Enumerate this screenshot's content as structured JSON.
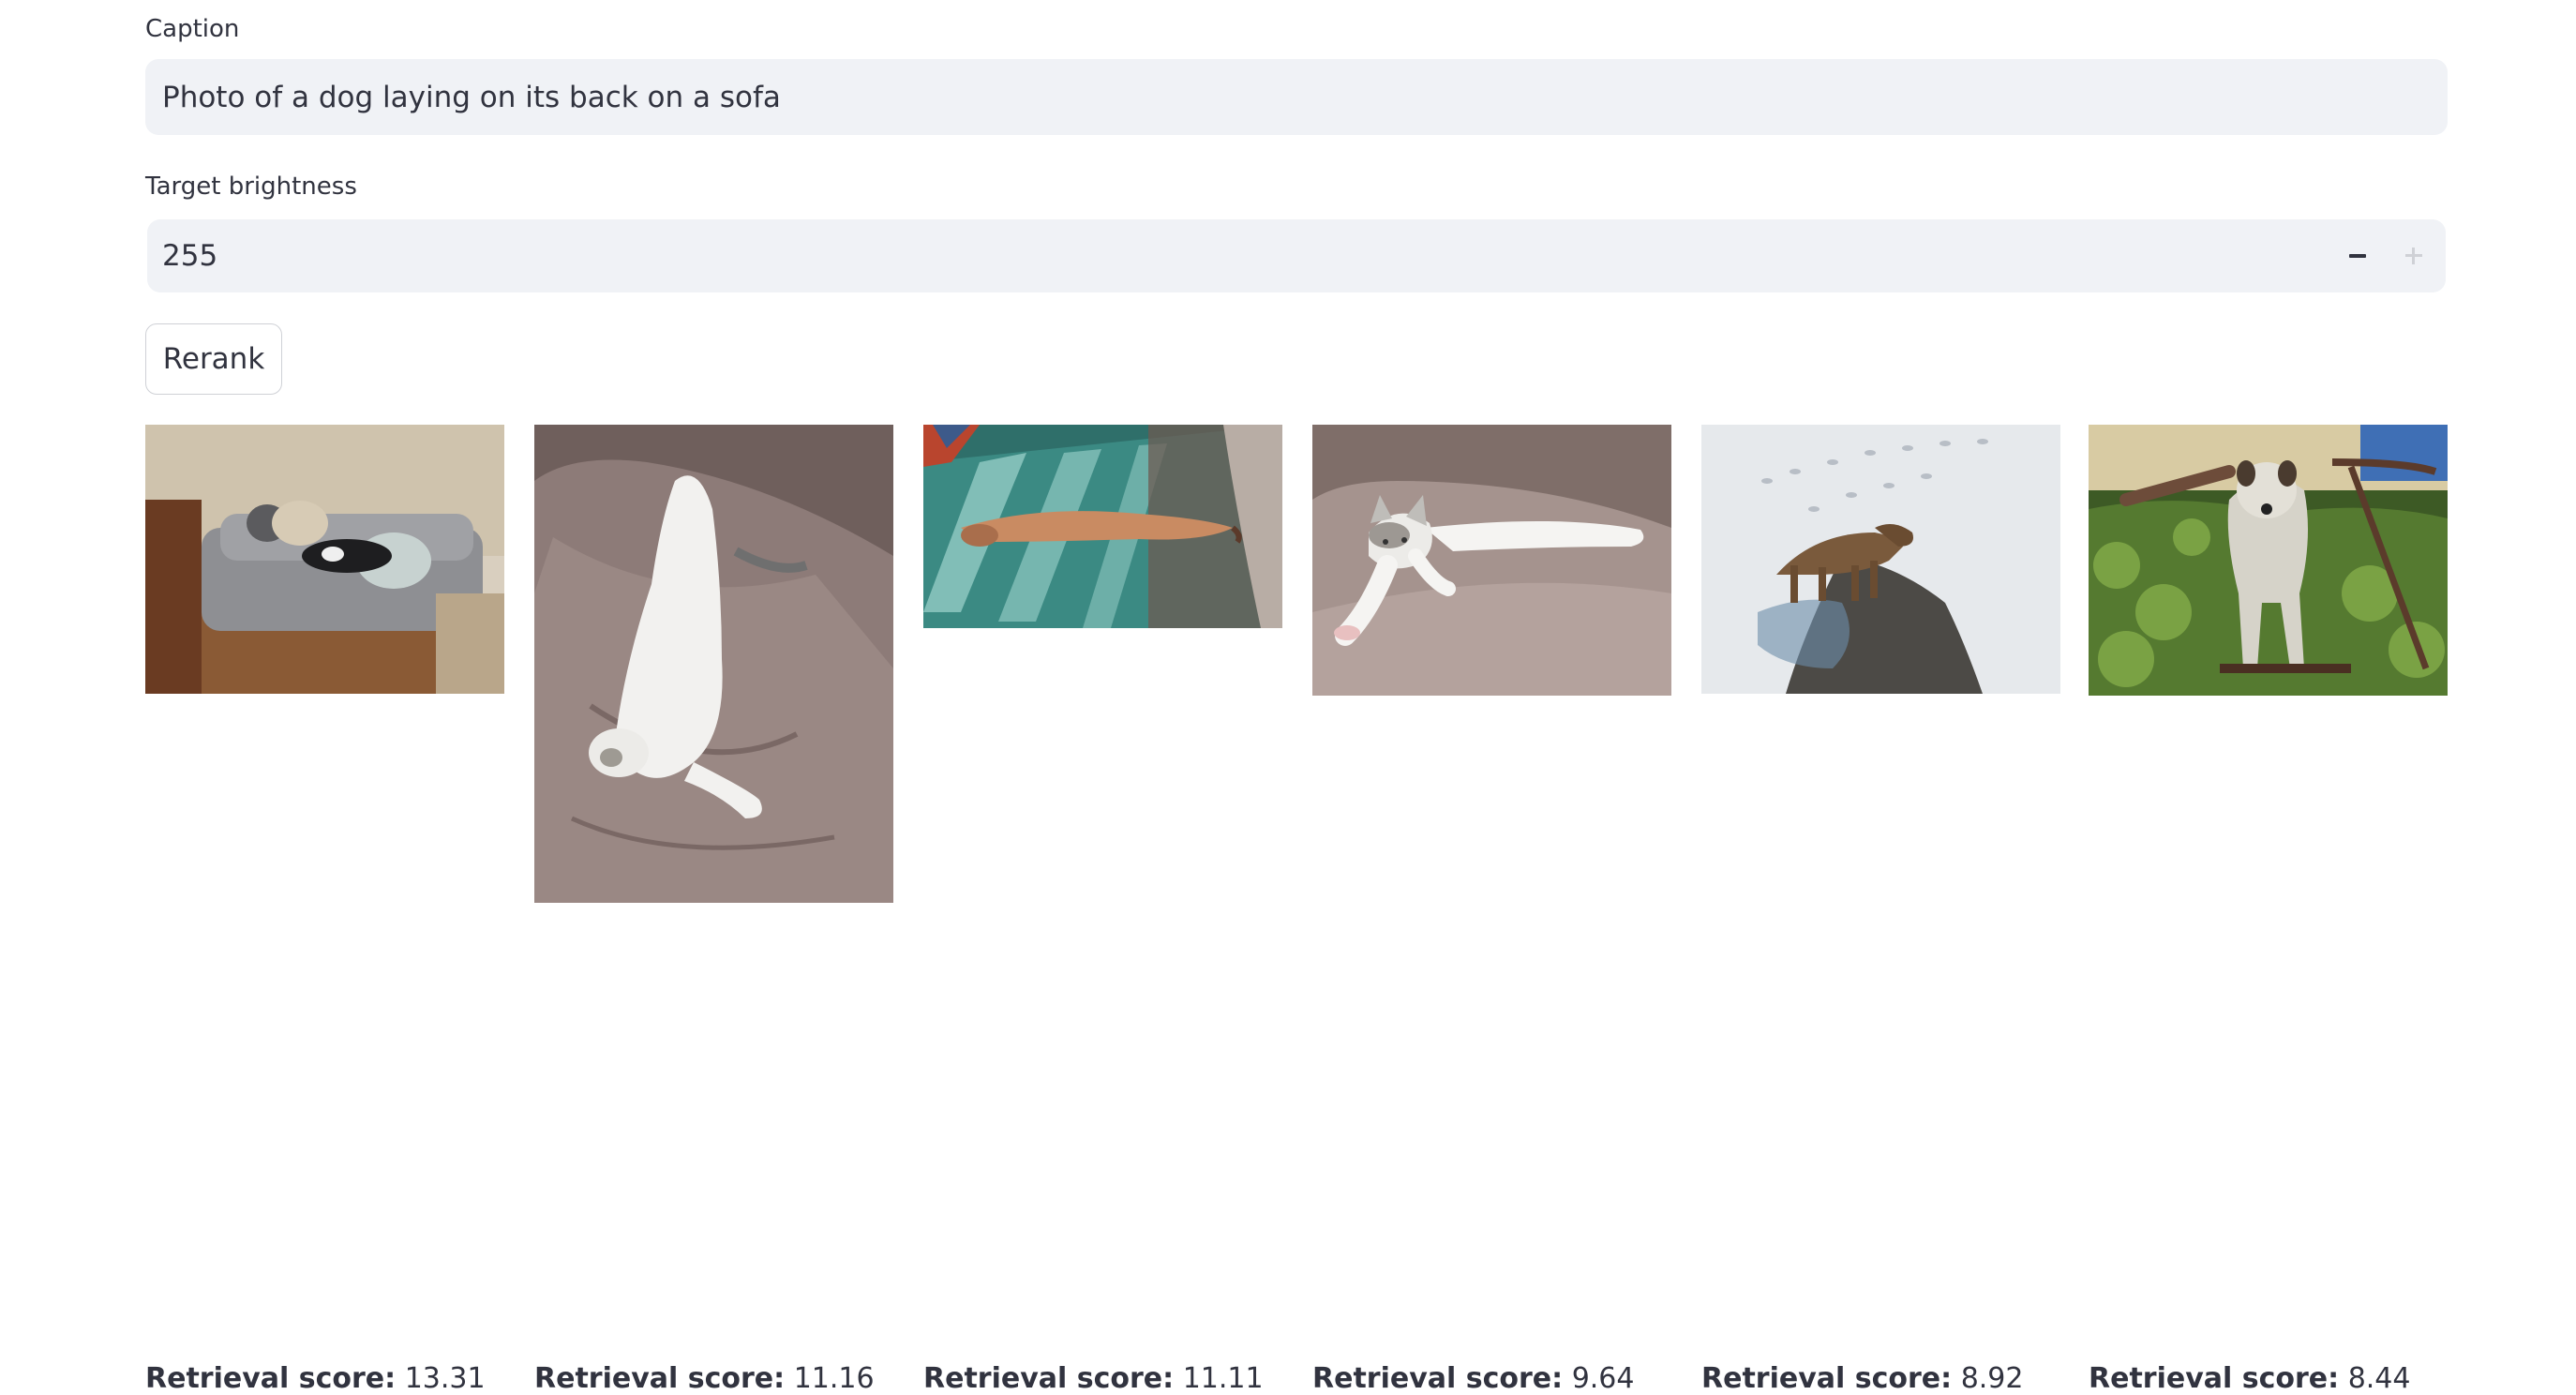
{
  "caption": {
    "label": "Caption",
    "value": "Photo of a dog laying on its back on a sofa"
  },
  "brightness": {
    "label": "Target brightness",
    "value": "255",
    "decrement_icon": "minus-icon",
    "increment_icon": "plus-icon"
  },
  "rerank_button": {
    "label": "Rerank"
  },
  "results": [
    {
      "score_label": "Retrieval score:",
      "score_value": "13.31"
    },
    {
      "score_label": "Retrieval score:",
      "score_value": "11.16"
    },
    {
      "score_label": "Retrieval score:",
      "score_value": "11.11"
    },
    {
      "score_label": "Retrieval score:",
      "score_value": "9.64"
    },
    {
      "score_label": "Retrieval score:",
      "score_value": "8.92"
    },
    {
      "score_label": "Retrieval score:",
      "score_value": "8.44"
    }
  ]
}
